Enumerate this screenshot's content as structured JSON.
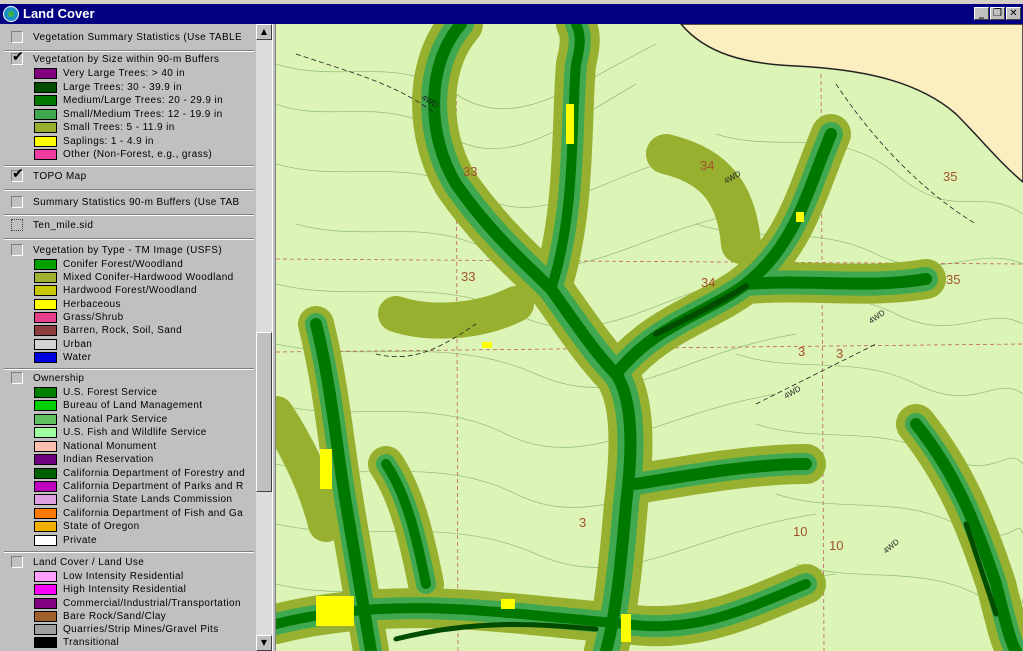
{
  "window": {
    "title": "Land Cover",
    "minimize_glyph": "_",
    "restore_glyph": "❐",
    "close_glyph": "✕"
  },
  "legend": {
    "layers": [
      {
        "label": "Vegetation Summary Statistics (Use TABLE",
        "checked": false
      },
      {
        "label": "Vegetation by Size within 90-m Buffers",
        "checked": true,
        "items": [
          {
            "label": "Very Large Trees: > 40  in",
            "color": "#800080"
          },
          {
            "label": "Large Trees: 30 - 39.9 in",
            "color": "#004d00"
          },
          {
            "label": "Medium/Large Trees: 20 - 29.9 in",
            "color": "#007800"
          },
          {
            "label": "Small/Medium Trees: 12 - 19.9 in",
            "color": "#40a850"
          },
          {
            "label": "Small Trees: 5 - 11.9 in",
            "color": "#98b030"
          },
          {
            "label": "Saplings: 1 - 4.9 in",
            "color": "#ffff00"
          },
          {
            "label": "Other (Non-Forest, e.g., grass)",
            "color": "#f03ca0"
          }
        ]
      },
      {
        "label": "TOPO Map",
        "checked": true
      },
      {
        "label": "Summary Statistics 90-m Buffers (Use TAB",
        "checked": false
      },
      {
        "label": "Ten_mile.sid",
        "checked": false
      },
      {
        "label": "Vegetation by Type - TM Image (USFS)",
        "checked": false,
        "items": [
          {
            "label": "Conifer Forest/Woodland",
            "color": "#00a000"
          },
          {
            "label": "Mixed Conifer-Hardwood Woodland",
            "color": "#a0b030"
          },
          {
            "label": "Hardwood Forest/Woodland",
            "color": "#c8c800"
          },
          {
            "label": "Herbaceous",
            "color": "#ffff00"
          },
          {
            "label": "Grass/Shrub",
            "color": "#e8408c"
          },
          {
            "label": "Barren, Rock, Soil, Sand",
            "color": "#8c3c3c"
          },
          {
            "label": "Urban",
            "color": "#d4d4d4"
          },
          {
            "label": "Water",
            "color": "#0000e0"
          }
        ]
      },
      {
        "label": "Ownership",
        "checked": false,
        "items": [
          {
            "label": "U.S. Forest Service",
            "color": "#008000"
          },
          {
            "label": "Bureau of Land Management",
            "color": "#00d000"
          },
          {
            "label": "National Park Service",
            "color": "#60c060"
          },
          {
            "label": "U.S. Fish and Wildlife Service",
            "color": "#a0ffa0"
          },
          {
            "label": "National Monument",
            "color": "#ffc0b0"
          },
          {
            "label": "Indian Reservation",
            "color": "#700080"
          },
          {
            "label": "California Department of Forestry and",
            "color": "#006000"
          },
          {
            "label": "California Department of Parks and R",
            "color": "#c000c0"
          },
          {
            "label": "California State Lands Commission",
            "color": "#e0a0e0"
          },
          {
            "label": "California Department of Fish and Ga",
            "color": "#ff7800"
          },
          {
            "label": "State of Oregon",
            "color": "#f0b000"
          },
          {
            "label": "Private",
            "color": "#ffffff"
          }
        ]
      },
      {
        "label": "Land Cover / Land Use",
        "checked": false,
        "items": [
          {
            "label": "Low Intensity Residential",
            "color": "#ffa0ff"
          },
          {
            "label": "High Intensity Residential",
            "color": "#ff00ff"
          },
          {
            "label": "Commercial/Industrial/Transportation",
            "color": "#800080"
          },
          {
            "label": "Bare Rock/Sand/Clay",
            "color": "#a0602c"
          },
          {
            "label": "Quarries/Strip Mines/Gravel Pits",
            "color": "#a0a0a0"
          },
          {
            "label": "Transitional",
            "color": "#000000"
          }
        ]
      }
    ]
  },
  "scrollbar": {
    "up_glyph": "▲",
    "down_glyph": "▼"
  },
  "map": {
    "section_labels": [
      "33",
      "33",
      "34",
      "35",
      "35",
      "3",
      "3",
      "3",
      "10",
      "10",
      "34"
    ],
    "road_label": "4WD",
    "colors": {
      "background": "#dcf5b6",
      "oregon": "#fbeec0",
      "contour": "#8ab870",
      "small_trees": "#98b030",
      "small_medium": "#40a850",
      "medium_large": "#007800",
      "large": "#004d00",
      "saplings": "#ffff00"
    }
  }
}
